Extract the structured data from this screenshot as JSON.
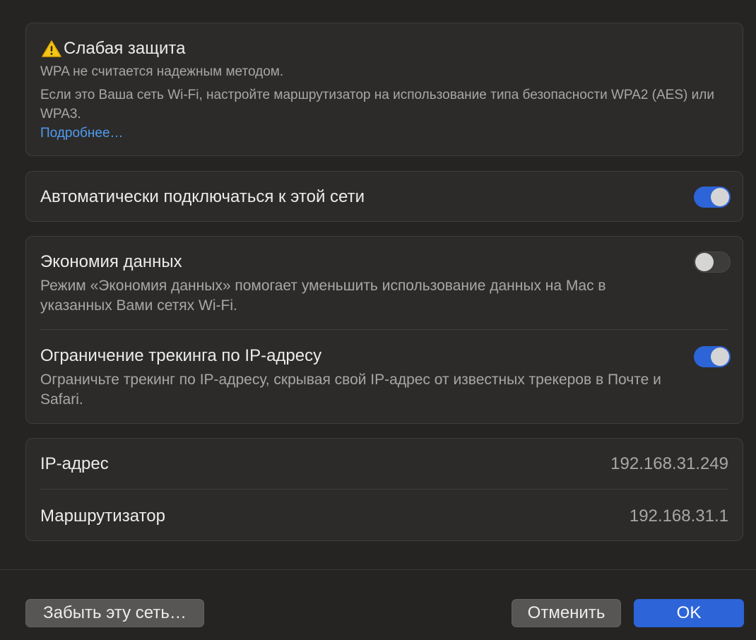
{
  "warning": {
    "icon": "warning-triangle-icon",
    "title": "Слабая защита",
    "line1": "WPA не считается надежным методом.",
    "line2": "Если это Ваша сеть Wi-Fi, настройте маршрутизатор на использование типа безопасности WPA2 (AES) или WPA3.",
    "link": "Подробнее…"
  },
  "auto_join": {
    "label": "Автоматически подключаться к этой сети",
    "enabled": true
  },
  "low_data": {
    "label": "Экономия данных",
    "description": "Режим «Экономия данных» помогает уменьшить использование данных на Mac в указанных Вами сетях Wi-Fi.",
    "enabled": false
  },
  "ip_tracking": {
    "label": "Ограничение трекинга по IP-адресу",
    "description": "Ограничьте трекинг по IP-адресу, скрывая свой IP-адрес от известных трекеров в Почте и Safari.",
    "enabled": true
  },
  "info": {
    "ip_label": "IP-адрес",
    "ip_value": "192.168.31.249",
    "router_label": "Маршрутизатор",
    "router_value": "192.168.31.1"
  },
  "buttons": {
    "forget": "Забыть эту сеть…",
    "cancel": "Отменить",
    "ok": "OK"
  },
  "colors": {
    "accent": "#2d64d8",
    "link": "#4f9bf2",
    "background": "#252422"
  }
}
